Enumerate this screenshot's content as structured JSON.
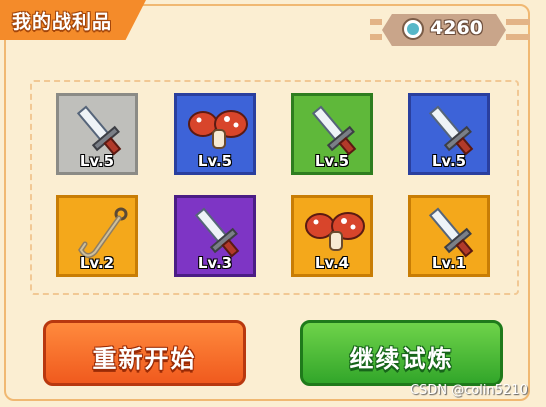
{
  "header": {
    "title": "我的战利品"
  },
  "currency": {
    "icon": "coin-icon",
    "value": "4260"
  },
  "colors": {
    "gray": "#bfbfbb",
    "blue": "#3d63d8",
    "green": "#5fb83a",
    "purple": "#7e35c5",
    "orange": "#f4a81b",
    "restart": "#f05a1e",
    "continue": "#32a62a"
  },
  "items": [
    {
      "icon": "sword-icon",
      "level": "Lv.5",
      "frame": "gray"
    },
    {
      "icon": "mushroom-icon",
      "level": "Lv.5",
      "frame": "blue"
    },
    {
      "icon": "sword-icon",
      "level": "Lv.5",
      "frame": "green"
    },
    {
      "icon": "sword-icon",
      "level": "Lv.5",
      "frame": "blue"
    },
    {
      "icon": "hook-icon",
      "level": "Lv.2",
      "frame": "orange"
    },
    {
      "icon": "sword-icon",
      "level": "Lv.3",
      "frame": "purple"
    },
    {
      "icon": "mushroom-icon",
      "level": "Lv.4",
      "frame": "orange"
    },
    {
      "icon": "sword-icon",
      "level": "Lv.1",
      "frame": "orange"
    }
  ],
  "buttons": {
    "restart_label": "重新开始",
    "continue_label": "继续试炼"
  },
  "watermark": "CSDN @colin5210"
}
